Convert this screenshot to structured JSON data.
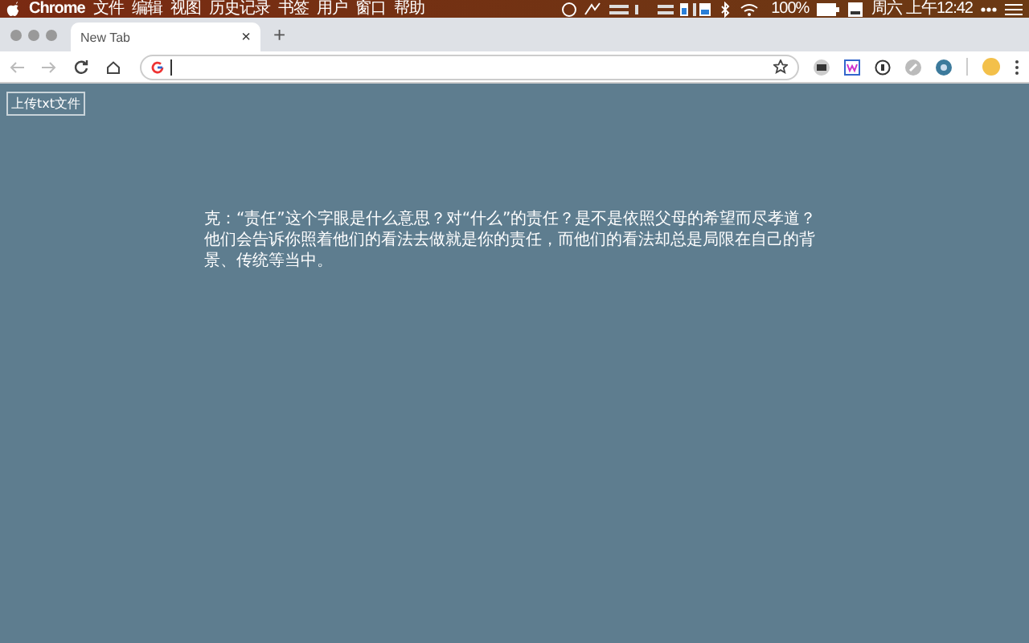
{
  "menu_bar": {
    "app": "Chrome",
    "items": [
      "文件",
      "编辑",
      "视图",
      "历史记录",
      "书签",
      "用户",
      "窗口",
      "帮助"
    ],
    "battery": "100%",
    "clock": "周六 上午12:42"
  },
  "tabs": [
    {
      "label": "New Tab",
      "selected": true,
      "close": "×"
    }
  ],
  "new_tab": "+",
  "page": {
    "upload_button": "上传txt文件",
    "paragraph": "克：“责任”这个字眼是什么意思？对“什么”的责任？是不是依照父母的希望而尽孝道？他们会告诉你照着他们的看法去做就是你的责任，而他们的看法却总是局限在自己的背景、传统等当中。"
  }
}
